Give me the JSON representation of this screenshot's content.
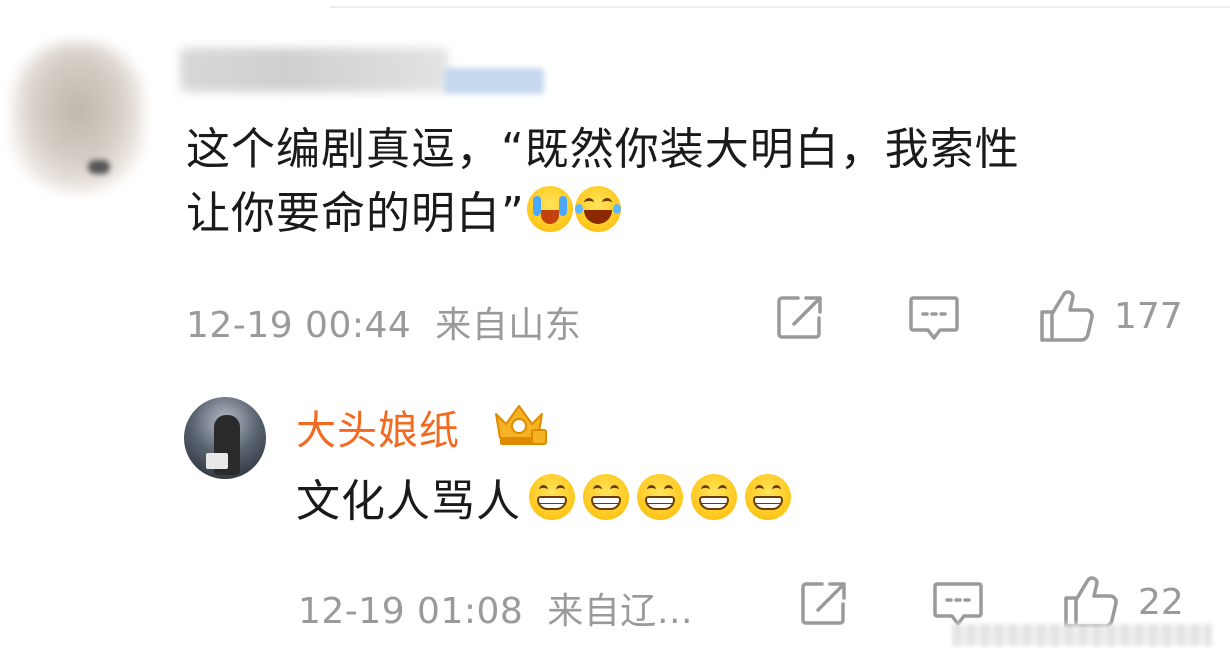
{
  "main_comment": {
    "text_line1": "这个编剧真逗，“既然你装大明白，我索性",
    "text_line2": "让你要命的明白”",
    "emojis": [
      "crying-laughing-emoji",
      "tears-of-joy-emoji"
    ],
    "timestamp": "12-19 00:44",
    "location": "来自山东",
    "like_count": "177"
  },
  "reply": {
    "username": "大头娘纸",
    "badge": "crown-badge",
    "text": "文化人骂人",
    "emoji_count": 5,
    "timestamp": "12-19 01:08",
    "location": "来自辽…",
    "like_count": "22"
  },
  "colors": {
    "text": "#1a1a1a",
    "meta": "#9a9a9a",
    "username_accent": "#f26a1f",
    "icon_gray": "#9a9a9a"
  },
  "icons": {
    "share": "share-icon",
    "comment": "comment-icon",
    "like": "thumbs-up-icon"
  }
}
